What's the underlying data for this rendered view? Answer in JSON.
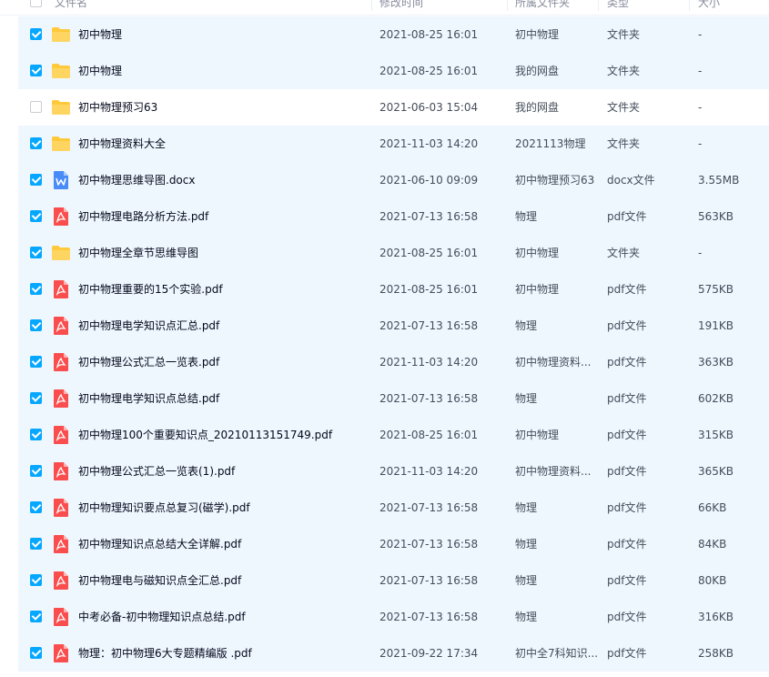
{
  "header": {
    "name": "文件名",
    "time": "修改时间",
    "dir": "所属文件夹",
    "type": "类型",
    "size": "大小"
  },
  "colors": {
    "accent": "#06a7ff",
    "folder": "#ffc93c",
    "pdf": "#fa4e4e",
    "word": "#4a8cf7",
    "checked_row": "#eef6fe"
  },
  "rows": [
    {
      "name": "初中物理",
      "time": "2021-08-25 16:01",
      "dir": "初中物理",
      "type": "文件夹",
      "size": "-",
      "icon": "folder-icon",
      "checked": true
    },
    {
      "name": "初中物理",
      "time": "2021-08-25 16:01",
      "dir": "我的网盘",
      "type": "文件夹",
      "size": "-",
      "icon": "folder-icon",
      "checked": true
    },
    {
      "name": "初中物理预习63",
      "time": "2021-06-03 15:04",
      "dir": "我的网盘",
      "type": "文件夹",
      "size": "-",
      "icon": "folder-icon",
      "checked": false
    },
    {
      "name": "初中物理资料大全",
      "time": "2021-11-03 14:20",
      "dir": "2021113物理",
      "type": "文件夹",
      "size": "-",
      "icon": "folder-icon",
      "checked": true
    },
    {
      "name": "初中物理思维导图.docx",
      "time": "2021-06-10 09:09",
      "dir": "初中物理预习63",
      "type": "docx文件",
      "size": "3.55MB",
      "icon": "word-icon",
      "checked": true
    },
    {
      "name": "初中物理电路分析方法.pdf",
      "time": "2021-07-13 16:58",
      "dir": "物理",
      "type": "pdf文件",
      "size": "563KB",
      "icon": "pdf-icon",
      "checked": true
    },
    {
      "name": "初中物理全章节思维导图",
      "time": "2021-08-25 16:01",
      "dir": "初中物理",
      "type": "文件夹",
      "size": "-",
      "icon": "folder-icon",
      "checked": true
    },
    {
      "name": "初中物理重要的15个实验.pdf",
      "time": "2021-08-25 16:01",
      "dir": "初中物理",
      "type": "pdf文件",
      "size": "575KB",
      "icon": "pdf-icon",
      "checked": true
    },
    {
      "name": "初中物理电学知识点汇总.pdf",
      "time": "2021-07-13 16:58",
      "dir": "物理",
      "type": "pdf文件",
      "size": "191KB",
      "icon": "pdf-icon",
      "checked": true
    },
    {
      "name": "初中物理公式汇总一览表.pdf",
      "time": "2021-11-03 14:20",
      "dir": "初中物理资料...",
      "type": "pdf文件",
      "size": "363KB",
      "icon": "pdf-icon",
      "checked": true
    },
    {
      "name": "初中物理电学知识点总结.pdf",
      "time": "2021-07-13 16:58",
      "dir": "物理",
      "type": "pdf文件",
      "size": "602KB",
      "icon": "pdf-icon",
      "checked": true
    },
    {
      "name": "初中物理100个重要知识点_20210113151749.pdf",
      "time": "2021-08-25 16:01",
      "dir": "初中物理",
      "type": "pdf文件",
      "size": "315KB",
      "icon": "pdf-icon",
      "checked": true
    },
    {
      "name": "初中物理公式汇总一览表(1).pdf",
      "time": "2021-11-03 14:20",
      "dir": "初中物理资料...",
      "type": "pdf文件",
      "size": "365KB",
      "icon": "pdf-icon",
      "checked": true
    },
    {
      "name": "初中物理知识要点总复习(磁学).pdf",
      "time": "2021-07-13 16:58",
      "dir": "物理",
      "type": "pdf文件",
      "size": "66KB",
      "icon": "pdf-icon",
      "checked": true
    },
    {
      "name": "初中物理知识点总结大全详解.pdf",
      "time": "2021-07-13 16:58",
      "dir": "物理",
      "type": "pdf文件",
      "size": "84KB",
      "icon": "pdf-icon",
      "checked": true
    },
    {
      "name": "初中物理电与磁知识点全汇总.pdf",
      "time": "2021-07-13 16:58",
      "dir": "物理",
      "type": "pdf文件",
      "size": "80KB",
      "icon": "pdf-icon",
      "checked": true
    },
    {
      "name": "中考必备-初中物理知识点总结.pdf",
      "time": "2021-07-13 16:58",
      "dir": "物理",
      "type": "pdf文件",
      "size": "316KB",
      "icon": "pdf-icon",
      "checked": true
    },
    {
      "name": "物理：初中物理6大专题精编版 .pdf",
      "time": "2021-09-22 17:34",
      "dir": "初中全7科知识...",
      "type": "pdf文件",
      "size": "258KB",
      "icon": "pdf-icon",
      "checked": true
    }
  ]
}
